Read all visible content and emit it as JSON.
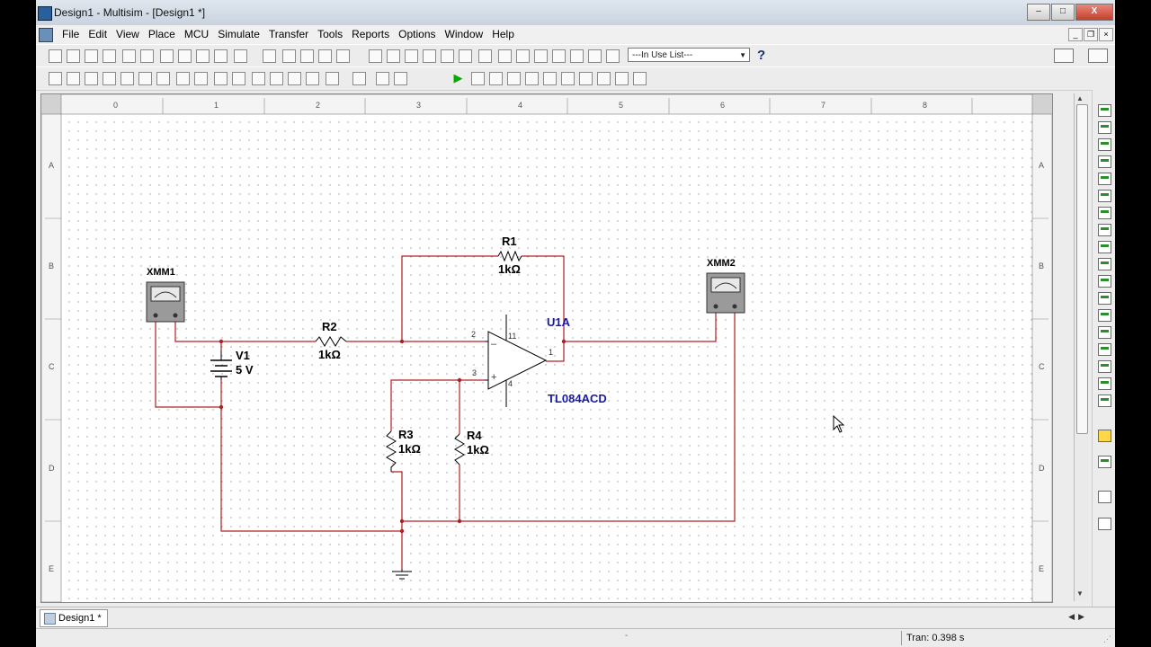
{
  "window": {
    "title": "Design1 - Multisim - [Design1 *]",
    "controls": {
      "minimize": "–",
      "maximize": "□",
      "close": "X"
    },
    "mdi_controls": {
      "minimize": "_",
      "restore": "❐",
      "close": "×"
    }
  },
  "menu": {
    "items": [
      "File",
      "Edit",
      "View",
      "Place",
      "MCU",
      "Simulate",
      "Transfer",
      "Tools",
      "Reports",
      "Options",
      "Window",
      "Help"
    ]
  },
  "toolbar": {
    "in_use_list": "---In Use List---",
    "help": "?"
  },
  "schematic": {
    "col_labels": [
      "0",
      "1",
      "2",
      "3",
      "4",
      "5",
      "6",
      "7",
      "8"
    ],
    "row_labels": [
      "A",
      "B",
      "C",
      "D",
      "E"
    ],
    "components": {
      "xmm1": "XMM1",
      "xmm2": "XMM2",
      "r1_name": "R1",
      "r1_value": "1kΩ",
      "r2_name": "R2",
      "r2_value": "1kΩ",
      "r3_name": "R3",
      "r3_value": "1kΩ",
      "r4_name": "R4",
      "r4_value": "1kΩ",
      "v1_name": "V1",
      "v1_value": "5 V",
      "u1_name": "U1A",
      "u1_part": "TL084ACD",
      "pin2": "2",
      "pin3": "3",
      "pin11": "11",
      "pin4": "4",
      "pin1": "1",
      "minus": "–",
      "plus": "+"
    },
    "colors": {
      "wire": "#b02020",
      "component": "#000000",
      "opamp_label": "#1a1aa0"
    }
  },
  "tabs": [
    {
      "label": "Design1 *"
    }
  ],
  "status": {
    "tran": "Tran: 0.398 s",
    "dots": "-"
  }
}
